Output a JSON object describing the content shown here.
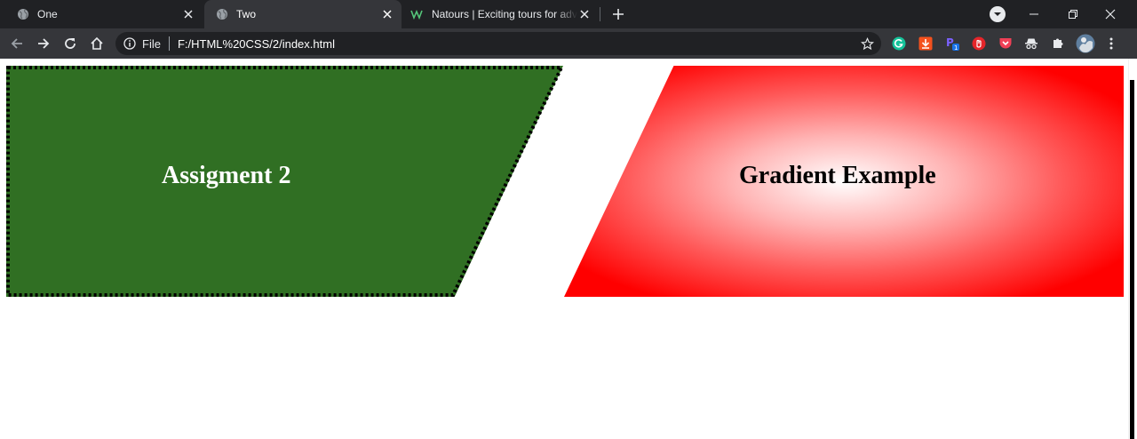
{
  "tabs": [
    {
      "title": "One",
      "active": false
    },
    {
      "title": "Two",
      "active": true
    },
    {
      "title": "Natours | Exciting tours for adven",
      "active": false
    }
  ],
  "address_bar": {
    "scheme_label": "File",
    "url": "F:/HTML%20CSS/2/index.html"
  },
  "page": {
    "box1_heading": "Assigment 2",
    "box2_heading": "Gradient Example"
  },
  "colors": {
    "tabstrip_bg": "#202124",
    "toolbar_bg": "#35363a",
    "green_box": "#306f23",
    "gradient_center": "#ffffff",
    "gradient_edge": "#ff0000"
  },
  "icons": {
    "tab_favicon": "globe-icon",
    "natours_favicon": "natours-logo-icon",
    "extensions": [
      "grammarly-icon",
      "download-icon",
      "p-extension-icon",
      "shield-icon",
      "pocket-icon",
      "incognito-icon",
      "puzzle-icon",
      "profile-avatar"
    ]
  }
}
